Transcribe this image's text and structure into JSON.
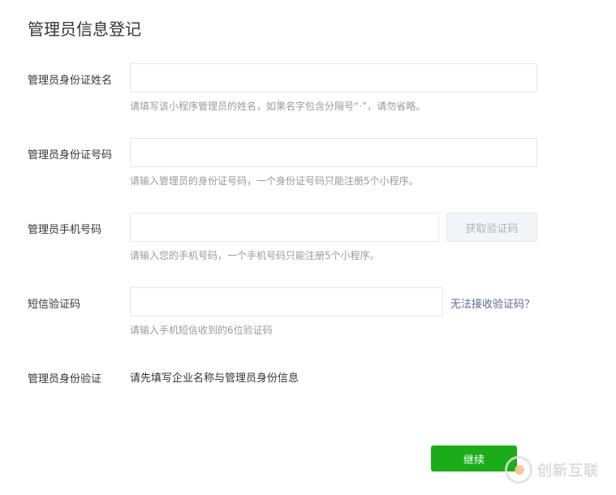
{
  "page": {
    "title": "管理员信息登记"
  },
  "form": {
    "name": {
      "label": "管理员身份证姓名",
      "value": "",
      "hint": "请填写该小程序管理员的姓名，如果名字包含分隔号“·”，请勿省略。"
    },
    "id_number": {
      "label": "管理员身份证号码",
      "value": "",
      "hint": "请输入管理员的身份证号码，一个身份证号码只能注册5个小程序。"
    },
    "phone": {
      "label": "管理员手机号码",
      "value": "",
      "code_button": "获取验证码",
      "hint": "请输入您的手机号码，一个手机号码只能注册5个小程序。"
    },
    "sms_code": {
      "label": "短信验证码",
      "value": "",
      "help_link": "无法接收验证码？",
      "hint": "请输入手机短信收到的6位验证码"
    },
    "identity_verify": {
      "label": "管理员身份验证",
      "text": "请先填写企业名称与管理员身份信息"
    },
    "submit_label": "继续"
  },
  "watermark": {
    "text": "创新互联",
    "icon": "chuangxin-logo-icon"
  },
  "colors": {
    "primary_button": "#1aad19",
    "link": "#576b95",
    "hint": "#9a9a9a"
  }
}
